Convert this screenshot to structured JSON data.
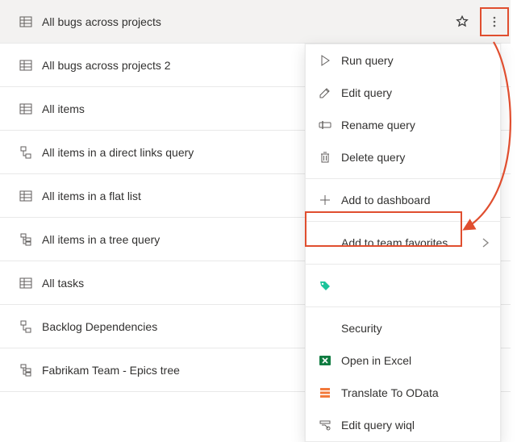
{
  "queries": [
    {
      "name": "All bugs across projects",
      "icon": "flat",
      "selected": true,
      "showStar": true,
      "showMore": true
    },
    {
      "name": "All bugs across projects 2",
      "icon": "flat",
      "selected": false,
      "showStar": false,
      "showMore": false
    },
    {
      "name": "All items",
      "icon": "flat",
      "selected": false,
      "showStar": false,
      "showMore": false
    },
    {
      "name": "All items in a direct links query",
      "icon": "direct",
      "selected": false,
      "showStar": false,
      "showMore": false
    },
    {
      "name": "All items in a flat list",
      "icon": "flat",
      "selected": false,
      "showStar": false,
      "showMore": false
    },
    {
      "name": "All items in a tree query",
      "icon": "tree",
      "selected": false,
      "showStar": false,
      "showMore": false
    },
    {
      "name": "All tasks",
      "icon": "flat",
      "selected": false,
      "showStar": false,
      "showMore": false
    },
    {
      "name": "Backlog Dependencies",
      "icon": "direct",
      "selected": false,
      "showStar": false,
      "showMore": false
    },
    {
      "name": "Fabrikam Team - Epics tree",
      "icon": "tree",
      "selected": false,
      "showStar": false,
      "showMore": false
    }
  ],
  "menu": {
    "run": "Run query",
    "edit": "Edit query",
    "rename": "Rename query",
    "delete": "Delete query",
    "addDash": "Add to dashboard",
    "addTeamFav": "Add to team favorites",
    "security": "Security",
    "excel": "Open in Excel",
    "odata": "Translate To OData",
    "wiql": "Edit query wiql"
  }
}
